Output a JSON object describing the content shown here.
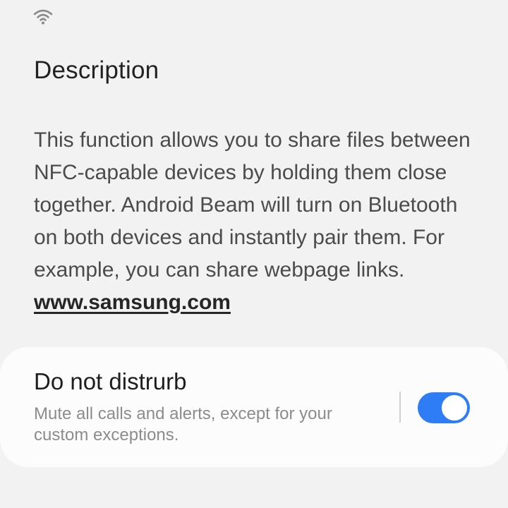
{
  "status_bar": {
    "icon": "wifi-icon",
    "icon_color": "#8a8a8a"
  },
  "description_section": {
    "title": "Description",
    "body": "This function allows you to share files between NFC-capable devices by holding them close together. Android Beam will turn on Bluetooth on both devices and instantly pair them. For example, you can share webpage links.",
    "link_text": "www.samsung.com"
  },
  "setting": {
    "title": "Do not distrurb",
    "subtitle": "Mute all calls and alerts, except for your custom exceptions.",
    "toggle_state": "on",
    "accent_color": "#2e7cf6"
  }
}
